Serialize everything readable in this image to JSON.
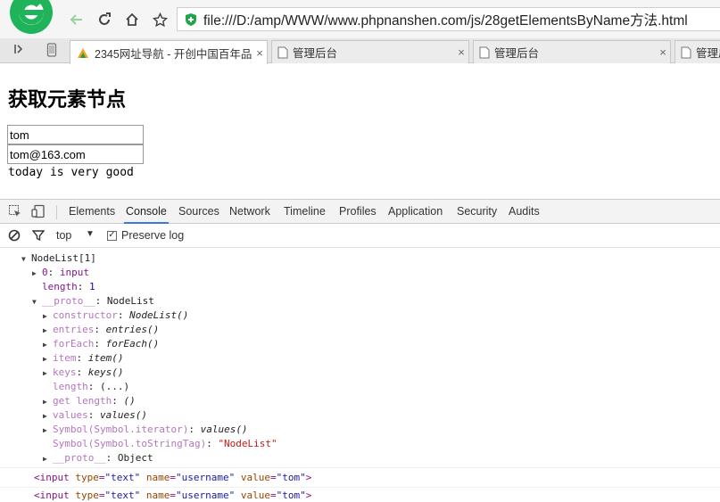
{
  "browser": {
    "url": "file:///D:/amp/WWW/www.phpnanshen.com/js/28getElementsByName方法.html",
    "tabs": [
      {
        "label": "2345网址导航 - 开创中国百年品",
        "close": "×"
      },
      {
        "label": "管理后台",
        "close": "×"
      },
      {
        "label": "管理后台",
        "close": "×"
      },
      {
        "label": "管理后",
        "close": ""
      }
    ]
  },
  "page": {
    "title": "获取元素节点",
    "inputs": [
      "tom",
      "tom@163.com"
    ],
    "text": "today is very good"
  },
  "devtools": {
    "tabs": [
      "Elements",
      "Console",
      "Sources",
      "Network",
      "Timeline",
      "Profiles",
      "Application",
      "Security",
      "Audits"
    ],
    "active_tab": "Console",
    "console_bar": {
      "context": "top",
      "preserve_log_label": "Preserve log",
      "preserve_log_checked": true
    },
    "output": {
      "root": "NodeList[1]",
      "item0": {
        "key": "0",
        "value": "input"
      },
      "length": {
        "key": "length",
        "value": "1"
      },
      "proto": {
        "key": "__proto__",
        "value": "NodeList"
      },
      "proto_items": [
        {
          "key": "constructor",
          "value": "NodeList()"
        },
        {
          "key": "entries",
          "value": "entries()"
        },
        {
          "key": "forEach",
          "value": "forEach()"
        },
        {
          "key": "item",
          "value": "item()"
        },
        {
          "key": "keys",
          "value": "keys()"
        },
        {
          "key": "length",
          "value": "(...)"
        },
        {
          "key": "get length",
          "value": "()"
        },
        {
          "key": "values",
          "value": "values()"
        },
        {
          "key": "Symbol(Symbol.iterator)",
          "value": "values()"
        },
        {
          "key": "Symbol(Symbol.toStringTag)",
          "value": "\"NodeList\""
        },
        {
          "key": "__proto__",
          "value": "Object"
        }
      ],
      "elements": [
        {
          "tag": "input",
          "type_attr": "type",
          "type_val": "\"text\"",
          "name_attr": "name",
          "name_val": "\"username\"",
          "value_attr": "value",
          "value_val": "\"tom\""
        },
        {
          "tag": "input",
          "type_attr": "type",
          "type_val": "\"text\"",
          "name_attr": "name",
          "name_val": "\"username\"",
          "value_attr": "value",
          "value_val": "\"tom\""
        }
      ]
    }
  },
  "colors": {
    "accent": "#3879d9",
    "logo_green": "#1fb35a",
    "shield_green": "#21a548"
  }
}
